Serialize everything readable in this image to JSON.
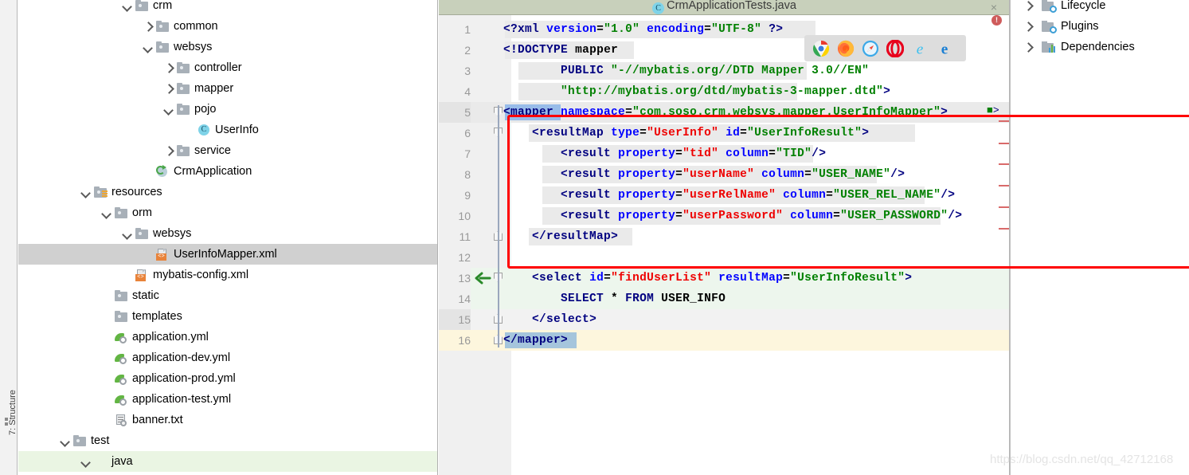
{
  "tool_strip": {
    "label": "7: Structure"
  },
  "project_tree": {
    "name": "Project tree",
    "items": [
      {
        "label": "crm",
        "indent": 4,
        "toggle": "down",
        "icon": "folder",
        "state": "normal"
      },
      {
        "label": "common",
        "indent": 5,
        "toggle": "right",
        "icon": "folder",
        "state": "normal"
      },
      {
        "label": "websys",
        "indent": 5,
        "toggle": "down",
        "icon": "folder",
        "state": "normal"
      },
      {
        "label": "controller",
        "indent": 6,
        "toggle": "right",
        "icon": "folder",
        "state": "normal"
      },
      {
        "label": "mapper",
        "indent": 6,
        "toggle": "right",
        "icon": "folder",
        "state": "normal"
      },
      {
        "label": "pojo",
        "indent": 6,
        "toggle": "down",
        "icon": "folder",
        "state": "normal"
      },
      {
        "label": "UserInfo",
        "indent": 7,
        "toggle": "none",
        "icon": "class-c",
        "state": "normal"
      },
      {
        "label": "service",
        "indent": 6,
        "toggle": "right",
        "icon": "folder",
        "state": "normal"
      },
      {
        "label": "CrmApplication",
        "indent": 5,
        "toggle": "none",
        "icon": "springapp",
        "state": "normal"
      },
      {
        "label": "resources",
        "indent": 2,
        "toggle": "down",
        "icon": "folder-res",
        "state": "normal"
      },
      {
        "label": "orm",
        "indent": 3,
        "toggle": "down",
        "icon": "folder",
        "state": "normal"
      },
      {
        "label": "websys",
        "indent": 4,
        "toggle": "down",
        "icon": "folder",
        "state": "normal"
      },
      {
        "label": "UserInfoMapper.xml",
        "indent": 5,
        "toggle": "none",
        "icon": "xmlfile",
        "state": "selected"
      },
      {
        "label": "mybatis-config.xml",
        "indent": 4,
        "toggle": "none",
        "icon": "xmlfile",
        "state": "normal"
      },
      {
        "label": "static",
        "indent": 3,
        "toggle": "none",
        "icon": "folder",
        "state": "normal"
      },
      {
        "label": "templates",
        "indent": 3,
        "toggle": "none",
        "icon": "folder",
        "state": "normal"
      },
      {
        "label": "application.yml",
        "indent": 3,
        "toggle": "none",
        "icon": "ymlfile",
        "state": "normal"
      },
      {
        "label": "application-dev.yml",
        "indent": 3,
        "toggle": "none",
        "icon": "ymlfile",
        "state": "normal"
      },
      {
        "label": "application-prod.yml",
        "indent": 3,
        "toggle": "none",
        "icon": "ymlfile",
        "state": "normal"
      },
      {
        "label": "application-test.yml",
        "indent": 3,
        "toggle": "none",
        "icon": "ymlfile",
        "state": "normal"
      },
      {
        "label": "banner.txt",
        "indent": 3,
        "toggle": "none",
        "icon": "txtfile",
        "state": "normal"
      },
      {
        "label": "test",
        "indent": 1,
        "toggle": "down",
        "icon": "folder",
        "state": "normal"
      },
      {
        "label": "java",
        "indent": 2,
        "toggle": "down",
        "icon": "folder-green",
        "state": "greenrow"
      }
    ]
  },
  "editor": {
    "tab": {
      "title": "CrmApplicationTests.java",
      "icon": "java-class-icon",
      "close": "×"
    },
    "error_badge": "!",
    "browser_popup": {
      "name": "open-in-browser-popup",
      "browsers": [
        "chrome-icon",
        "firefox-icon",
        "safari-icon",
        "opera-icon",
        "internet-explorer-icon",
        "edge-icon"
      ]
    },
    "line_numbers": [
      "1",
      "2",
      "3",
      "4",
      "5",
      "6",
      "7",
      "8",
      "9",
      "10",
      "11",
      "12",
      "13",
      "14",
      "15",
      "16"
    ],
    "run_arrow_line": "13",
    "code_lines": [
      {
        "n": 1,
        "text": "<?xml version=\"1.0\" encoding=\"UTF-8\" ?>"
      },
      {
        "n": 2,
        "text": "<!DOCTYPE mapper"
      },
      {
        "n": 3,
        "text": "        PUBLIC \"-//mybatis.org//DTD Mapper 3.0//EN\""
      },
      {
        "n": 4,
        "text": "        \"http://mybatis.org/dtd/mybatis-3-mapper.dtd\">"
      },
      {
        "n": 5,
        "text": "<mapper namespace=\"com.soso.crm.websys.mapper.UserInfoMapper\">"
      },
      {
        "n": 6,
        "text": "    <resultMap type=\"UserInfo\" id=\"UserInfoResult\">"
      },
      {
        "n": 7,
        "text": "        <result property=\"tid\" column=\"TID\"/>"
      },
      {
        "n": 8,
        "text": "        <result property=\"userName\" column=\"USER_NAME\"/>"
      },
      {
        "n": 9,
        "text": "        <result property=\"userRelName\" column=\"USER_REL_NAME\"/>"
      },
      {
        "n": 10,
        "text": "        <result property=\"userPassword\" column=\"USER_PASSWORD\"/>"
      },
      {
        "n": 11,
        "text": "    </resultMap>"
      },
      {
        "n": 12,
        "text": ""
      },
      {
        "n": 13,
        "text": "    <select id=\"findUserList\" resultMap=\"UserInfoResult\">"
      },
      {
        "n": 14,
        "text": "        SELECT * FROM USER_INFO"
      },
      {
        "n": 15,
        "text": "    </select>"
      },
      {
        "n": 16,
        "text": "</mapper>"
      }
    ],
    "annotation": {
      "name": "red-highlight-box",
      "covers_lines": "6-11"
    }
  },
  "maven_panel": {
    "name": "Maven tool window",
    "items": [
      {
        "label": "Lifecycle",
        "icon": "lifecycle-folder-icon"
      },
      {
        "label": "Plugins",
        "icon": "plugins-folder-icon"
      },
      {
        "label": "Dependencies",
        "icon": "dependencies-bars-icon"
      }
    ]
  },
  "watermark": {
    "text": "https://blog.csdn.net/qq_42712168"
  },
  "colors": {
    "tab_bar": "#c8d0bb",
    "selection_blue": "#a6cdfe",
    "selected_row": "#d0d0d0",
    "green_row": "#eaf5e3",
    "yellow_row": "#fdf6dd",
    "annotation_red": "#ff0000",
    "string_green": "#008000",
    "attr_blue": "#0000ff",
    "value_red": "#ee0000",
    "tag_navy": "#000080"
  }
}
